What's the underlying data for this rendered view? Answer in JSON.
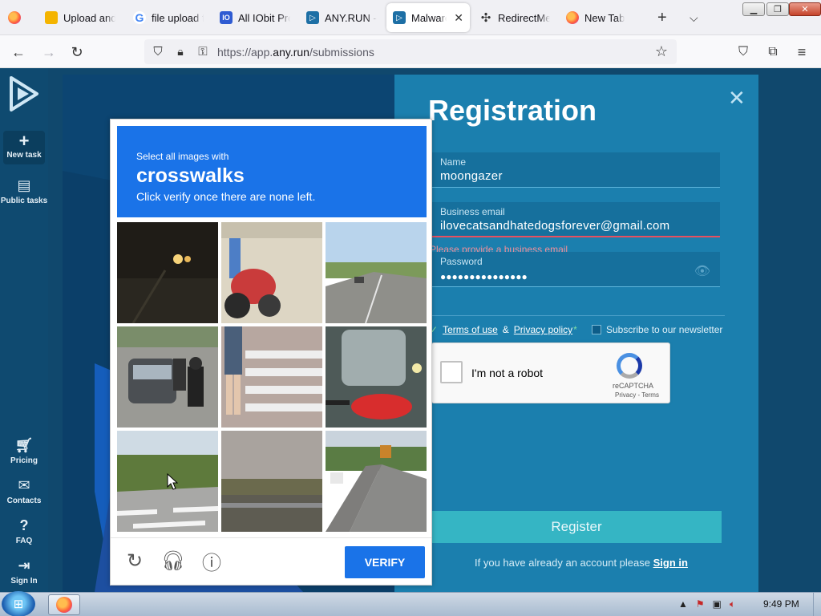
{
  "browser": {
    "tabs": [
      {
        "label": "",
        "icon": "firefox-icon",
        "active": false
      },
      {
        "label": "Upload and",
        "icon": "upload-icon",
        "active": false
      },
      {
        "label": "file upload f",
        "icon": "google-icon",
        "active": false
      },
      {
        "label": "All IObit Pro",
        "icon": "iobit-icon",
        "active": false
      },
      {
        "label": "ANY.RUN - I",
        "icon": "anyrun-icon",
        "active": false
      },
      {
        "label": "Malware",
        "icon": "anyrun-icon",
        "active": true
      },
      {
        "label": "RedirectMe",
        "icon": "redirect-icon",
        "active": false
      },
      {
        "label": "New Tab",
        "icon": "firefox-icon",
        "active": false
      }
    ],
    "url_prefix": "https://app.",
    "url_domain": "any.run",
    "url_path": "/submissions"
  },
  "sidebar": {
    "items": [
      {
        "label": "New task",
        "icon": "plus-icon"
      },
      {
        "label": "Public tasks",
        "icon": "document-icon"
      },
      {
        "label": "Pricing",
        "icon": "cart-icon"
      },
      {
        "label": "Contacts",
        "icon": "mail-icon"
      },
      {
        "label": "FAQ",
        "icon": "help-icon"
      },
      {
        "label": "Sign In",
        "icon": "signin-icon"
      }
    ]
  },
  "registration": {
    "title": "Registration",
    "name_label": "Name",
    "name_value": "moongazer",
    "email_label": "Business email",
    "email_value": "ilovecatsandhatedogsforever@gmail.com",
    "email_error": "Please provide a business email",
    "password_label": "Password",
    "password_value": "●●●●●●●●●●●●●●●",
    "terms_label": "Terms of use",
    "amp": "&",
    "privacy_label": "Privacy policy",
    "required_mark": "*",
    "newsletter_label": "Subscribe to our newsletter",
    "register_button": "Register",
    "signin_prompt": "If you have already an account please",
    "signin_link": "Sign in"
  },
  "recaptcha": {
    "label": "I'm not a robot",
    "brand": "reCAPTCHA",
    "links": "Privacy - Terms"
  },
  "challenge": {
    "instruction": "Select all images with",
    "target": "crosswalks",
    "subtext": "Click verify once there are none left.",
    "verify_button": "VERIFY",
    "tiles": [
      "night-road",
      "motorcycle-pole",
      "highway",
      "traffic-motorbikes",
      "crosswalk-pedestrian",
      "red-scooter",
      "crosswalk-vegetation",
      "guardrail-dusk",
      "road-truck"
    ]
  },
  "taskbar": {
    "clock": "9:49 PM"
  },
  "colors": {
    "accent": "#1a73e8",
    "page_bg": "#14577f",
    "register_bg": "#35b5c4",
    "error": "#e7505f"
  }
}
